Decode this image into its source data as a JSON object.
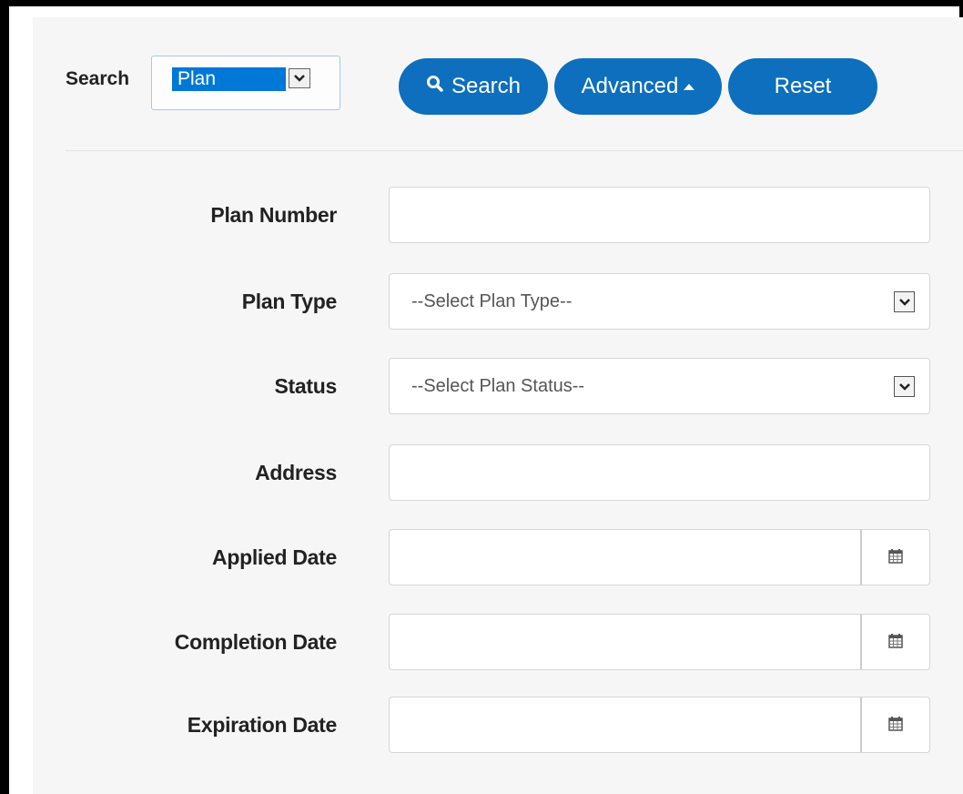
{
  "search_bar": {
    "label": "Search",
    "type_select_value": "Plan",
    "buttons": {
      "search": "Search",
      "advanced": "Advanced",
      "reset": "Reset"
    }
  },
  "form": {
    "plan_number": {
      "label": "Plan Number",
      "value": ""
    },
    "plan_type": {
      "label": "Plan Type",
      "placeholder": "--Select Plan Type--"
    },
    "status": {
      "label": "Status",
      "placeholder": "--Select Plan Status--"
    },
    "address": {
      "label": "Address",
      "value": ""
    },
    "applied_date": {
      "label": "Applied Date",
      "value": ""
    },
    "completion_date": {
      "label": "Completion Date",
      "value": ""
    },
    "expiration_date": {
      "label": "Expiration Date",
      "value": ""
    }
  },
  "icons": {
    "search": "magnifier-icon",
    "advanced_toggle": "caret-up-icon",
    "dropdown": "chevron-down-icon",
    "calendar": "calendar-icon"
  },
  "colors": {
    "button_bg": "#0d6fbd",
    "selection_bg": "#0078d7",
    "panel_bg": "#f6f6f6"
  }
}
